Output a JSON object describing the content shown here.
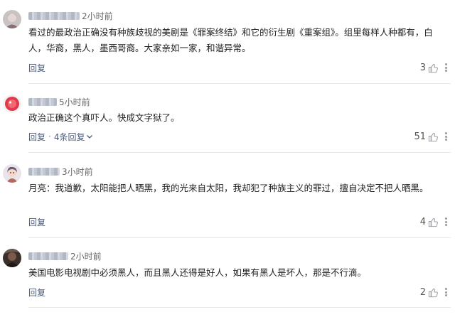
{
  "comments": [
    {
      "username": "",
      "time": "2小时前",
      "text": "看过的最政治正确没有种族歧视的美剧是《罪案终结》和它的衍生剧《重案组》。组里每样人种都有，白人，华裔，黑人，墨西哥裔。大家亲如一家，和谐异常。",
      "reply_label": "回复",
      "likes": "3",
      "avatar": "gray-face-avatar"
    },
    {
      "username": "",
      "time": "5小时前",
      "text": "政治正确这个真吓人。快成文字狱了。",
      "reply_label": "回复",
      "more_replies": "4条回复",
      "likes": "51",
      "avatar": "red-circle-avatar"
    },
    {
      "username": "",
      "time": "3小时前",
      "text": "月亮：我道歉，太阳能把人晒黑，我的光来自太阳，我却犯了种族主义的罪过，擅自决定不把人晒黑。",
      "reply_label": "回复",
      "likes": "4",
      "avatar": "cartoon-avatar"
    },
    {
      "username": "",
      "time": "2小时前",
      "text": "美国电影电视剧中必须黑人，而且黑人还得是好人，如果有黑人是坏人，那是不行滴。",
      "reply_label": "回复",
      "likes": "2",
      "avatar": "dark-photo-avatar"
    }
  ],
  "colors": {
    "action_link": "#4a5a7a",
    "divider": "#e8e8e8",
    "text": "#222222"
  }
}
